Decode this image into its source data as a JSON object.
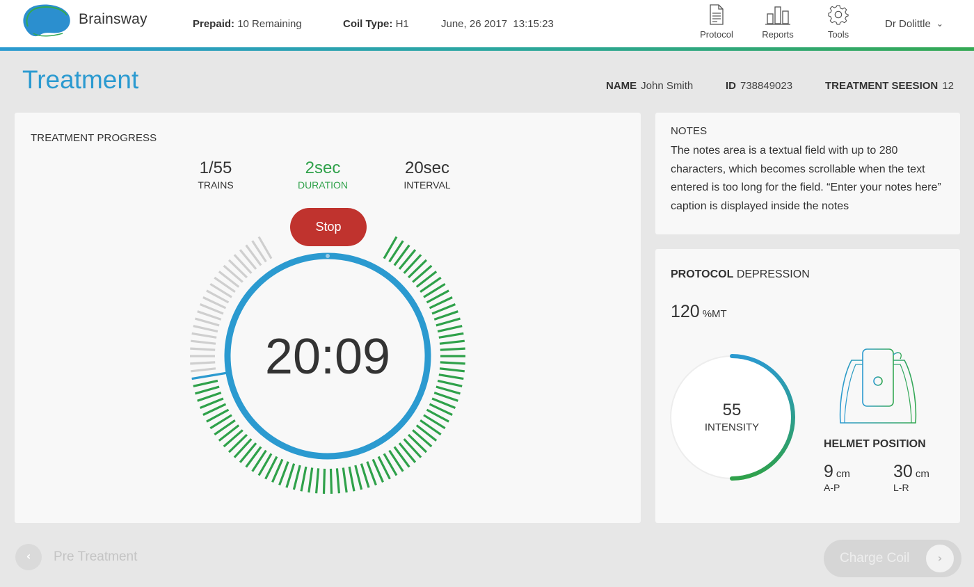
{
  "header": {
    "brand": "Brainsway",
    "prepaid_label": "Prepaid:",
    "prepaid_value": "10 Remaining",
    "coil_label": "Coil Type:",
    "coil_value": "H1",
    "datetime": "June, 26 2017  13:15:23",
    "nav": [
      {
        "label": "Protocol",
        "icon": "document-icon"
      },
      {
        "label": "Reports",
        "icon": "bar-chart-icon"
      },
      {
        "label": "Tools",
        "icon": "gear-icon"
      }
    ],
    "user": "Dr Dolittle"
  },
  "page": {
    "title": "Treatment",
    "name_label": "NAME",
    "name_value": "John Smith",
    "id_label": "ID",
    "id_value": "738849023",
    "session_label": "TREATMENT SEESION",
    "session_value": "12"
  },
  "progress": {
    "title": "TREATMENT PROGRESS",
    "trains_value": "1/55",
    "trains_label": "TRAINS",
    "duration_value": "2sec",
    "duration_label": "DURATION",
    "interval_value": "20sec",
    "interval_label": "INTERVAL",
    "stop_label": "Stop",
    "timer": "20:09",
    "completed_fraction": 0.76
  },
  "notes": {
    "title": "NOTES",
    "text": "The notes area is a textual field with up to 280 characters, which becomes scrollable when the text entered is too long for the field. “Enter your notes here” caption is displayed inside the notes"
  },
  "protocol": {
    "title_bold": "PROTOCOL",
    "title_rest": "DEPRESSION",
    "mt_value": "120",
    "mt_unit": "%MT",
    "intensity_value": "55",
    "intensity_label": "INTENSITY",
    "intensity_fraction": 0.5,
    "helmet_title": "HELMET POSITION",
    "ap_value": "9",
    "ap_unit": "cm",
    "ap_label": "A-P",
    "lr_value": "30",
    "lr_unit": "cm",
    "lr_label": "L-R"
  },
  "footer": {
    "back_label": "Pre Treatment",
    "charge_label": "Charge Coil"
  },
  "colors": {
    "accent_blue": "#2b9ad0",
    "accent_green": "#2fa14a",
    "stop_red": "#c0332e"
  }
}
